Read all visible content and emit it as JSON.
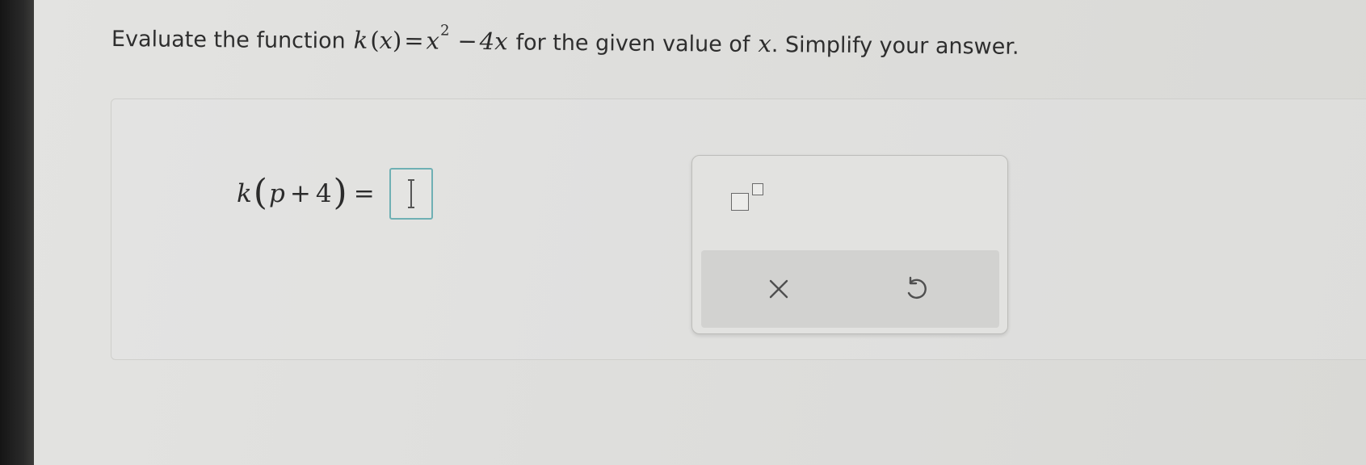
{
  "question": {
    "prefix": "Evaluate the function",
    "func_name": "k",
    "open_paren": "(",
    "var": "x",
    "close_paren": ")",
    "equals": "=",
    "base": "x",
    "exponent": "2",
    "minus": "−",
    "coef_term": "4x",
    "mid_text": "for the given value of",
    "value_var": "x",
    "suffix": ". Simplify your answer."
  },
  "expression": {
    "func_name": "k",
    "open_paren": "(",
    "var": "p",
    "plus": "+",
    "constant": "4",
    "close_paren": ")",
    "equals": "="
  },
  "answer": {
    "value": ""
  },
  "keypad": {
    "exponent_button": "exponent-template",
    "clear_symbol": "×",
    "undo_symbol": "undo"
  },
  "colors": {
    "answer_box_border": "#6fb0b4",
    "icon_color": "#4f4f4f"
  }
}
